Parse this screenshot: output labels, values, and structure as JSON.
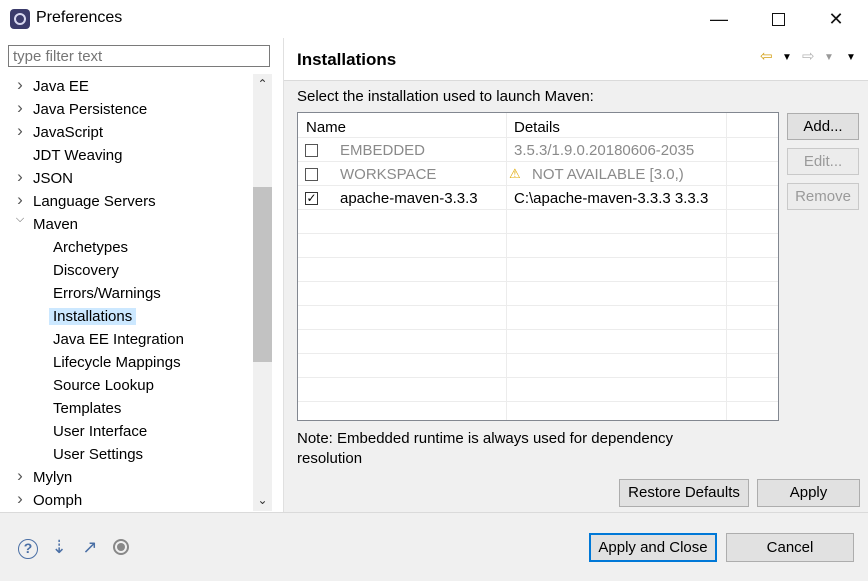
{
  "window": {
    "title": "Preferences"
  },
  "filter": {
    "placeholder": "type filter text"
  },
  "tree": {
    "items": [
      {
        "label": "Java EE",
        "expandable": true,
        "expanded": false,
        "level": 0
      },
      {
        "label": "Java Persistence",
        "expandable": true,
        "expanded": false,
        "level": 0
      },
      {
        "label": "JavaScript",
        "expandable": true,
        "expanded": false,
        "level": 0
      },
      {
        "label": "JDT Weaving",
        "expandable": false,
        "level": 0
      },
      {
        "label": "JSON",
        "expandable": true,
        "expanded": false,
        "level": 0
      },
      {
        "label": "Language Servers",
        "expandable": true,
        "expanded": false,
        "level": 0
      },
      {
        "label": "Maven",
        "expandable": true,
        "expanded": true,
        "level": 0
      },
      {
        "label": "Archetypes",
        "level": 1
      },
      {
        "label": "Discovery",
        "level": 1
      },
      {
        "label": "Errors/Warnings",
        "level": 1
      },
      {
        "label": "Installations",
        "level": 1,
        "selected": true
      },
      {
        "label": "Java EE Integration",
        "level": 1
      },
      {
        "label": "Lifecycle Mappings",
        "level": 1
      },
      {
        "label": "Source Lookup",
        "level": 1
      },
      {
        "label": "Templates",
        "level": 1
      },
      {
        "label": "User Interface",
        "level": 1
      },
      {
        "label": "User Settings",
        "level": 1
      },
      {
        "label": "Mylyn",
        "expandable": true,
        "expanded": false,
        "level": 0
      },
      {
        "label": "Oomph",
        "expandable": true,
        "expanded": false,
        "level": 0
      }
    ]
  },
  "page": {
    "title": "Installations",
    "description": "Select the installation used to launch Maven:",
    "table": {
      "columns": [
        "Name",
        "Details"
      ],
      "rows": [
        {
          "checked": false,
          "name": "EMBEDDED",
          "details": "3.5.3/1.9.0.20180606-2035",
          "greyed": true,
          "warning": false
        },
        {
          "checked": false,
          "name": "WORKSPACE",
          "details": "NOT AVAILABLE [3.0,)",
          "greyed": true,
          "warning": true
        },
        {
          "checked": true,
          "name": "apache-maven-3.3.3",
          "details": "C:\\apache-maven-3.3.3 3.3.3",
          "greyed": false,
          "warning": false
        }
      ]
    },
    "buttons": {
      "add": "Add...",
      "edit": "Edit...",
      "remove": "Remove"
    },
    "note": "Note: Embedded runtime is always used for dependency resolution",
    "restore_defaults": "Restore Defaults",
    "apply": "Apply"
  },
  "footer": {
    "apply_close": "Apply and Close",
    "cancel": "Cancel"
  },
  "colors": {
    "selection": "#cce8ff",
    "default_button_border": "#0078d7",
    "warning": "#e0a800"
  }
}
